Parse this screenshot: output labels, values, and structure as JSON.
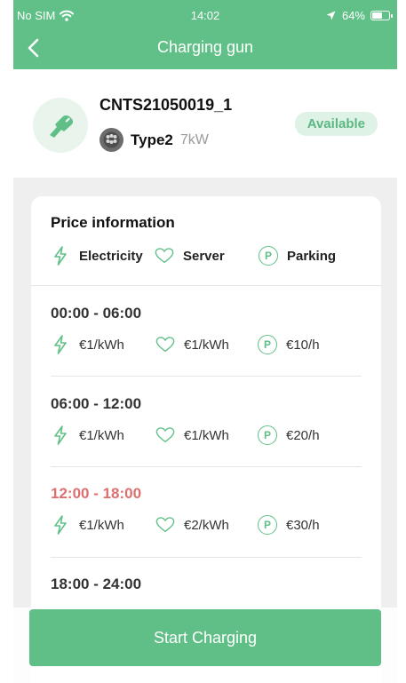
{
  "status_bar": {
    "carrier": "No SIM",
    "time": "14:02",
    "battery": "64%",
    "battery_level": 0.64
  },
  "nav": {
    "title": "Charging gun",
    "back_icon": "chevron-left-icon"
  },
  "device": {
    "code": "CNTS21050019_1",
    "connector_type": "Type2",
    "power": "7kW",
    "status": "Available",
    "icon": "charging-gun-icon"
  },
  "price": {
    "title": "Price information",
    "legend": [
      {
        "icon": "lightning-icon",
        "label": "Electricity"
      },
      {
        "icon": "heart-icon",
        "label": "Server"
      },
      {
        "icon": "parking-icon",
        "label": "Parking"
      }
    ],
    "slots": [
      {
        "time": "00:00 - 06:00",
        "electricity": "€1/kWh",
        "server": "€1/kWh",
        "parking": "€10/h",
        "highlight": false
      },
      {
        "time": "06:00 - 12:00",
        "electricity": "€1/kWh",
        "server": "€1/kWh",
        "parking": "€20/h",
        "highlight": false
      },
      {
        "time": "12:00 - 18:00",
        "electricity": "€1/kWh",
        "server": "€2/kWh",
        "parking": "€30/h",
        "highlight": true
      },
      {
        "time": "18:00 - 24:00",
        "electricity": "",
        "server": "",
        "parking": "",
        "highlight": false
      }
    ]
  },
  "actions": {
    "start_label": "Start Charging"
  },
  "colors": {
    "brand_green": "#60c087",
    "highlight_red": "#dd6f6f",
    "badge_bg": "#dff2e6"
  }
}
